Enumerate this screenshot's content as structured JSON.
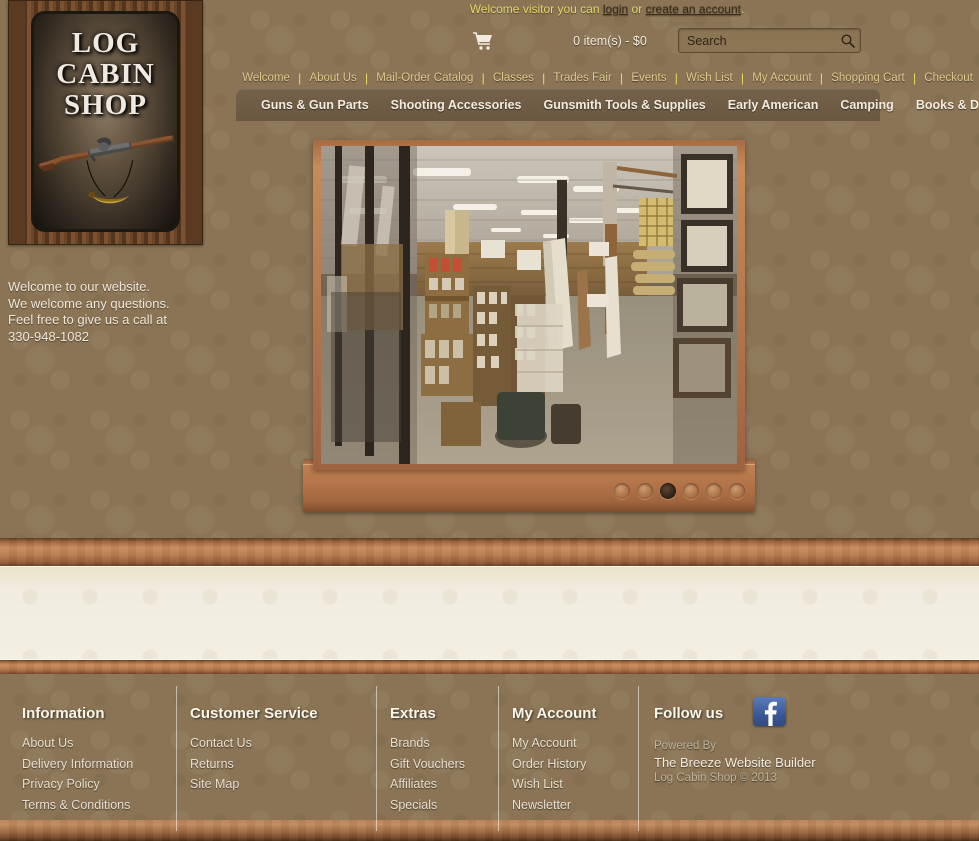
{
  "site": {
    "logo_line1": "LOG",
    "logo_line2": "CABIN",
    "logo_line3": "SHOP",
    "logo_alt": "Log Cabin Shop wooden sign with muzzleloader rifle and powder horn"
  },
  "header": {
    "welcome_prefix": "Welcome visitor you can ",
    "login_label": "login",
    "welcome_mid": " or ",
    "create_account_label": "create an account",
    "welcome_suffix": ".",
    "cart_total": "0 item(s) - $0",
    "cart_icon": "shopping-cart-icon",
    "search_placeholder": "Search",
    "search_value": "",
    "search_icon": "search-icon"
  },
  "top_nav": {
    "items": [
      {
        "label": "Welcome"
      },
      {
        "label": "About Us"
      },
      {
        "label": "Mail-Order Catalog"
      },
      {
        "label": "Classes"
      },
      {
        "label": "Trades Fair"
      },
      {
        "label": "Events"
      },
      {
        "label": "Wish List"
      },
      {
        "label": "My Account"
      },
      {
        "label": "Shopping Cart"
      },
      {
        "label": "Checkout"
      }
    ],
    "separator": "|"
  },
  "category_nav": {
    "items": [
      {
        "label": "Guns & Gun Parts"
      },
      {
        "label": "Shooting Accessories"
      },
      {
        "label": "Gunsmith Tools & Supplies"
      },
      {
        "label": "Early American"
      },
      {
        "label": "Camping"
      },
      {
        "label": "Books & DVDs"
      }
    ]
  },
  "intro": {
    "line1": "Welcome to our website.",
    "line2": "We welcome any questions.",
    "line3": "Feel free to give us a call at",
    "line4": "330-948-1082"
  },
  "slider": {
    "slide_alt": "Interior of the Log Cabin Shop retail store showing aisles of shelving, muzzleloader rifles, supplies and framed pictures",
    "dots": [
      {
        "active": false
      },
      {
        "active": false
      },
      {
        "active": true
      },
      {
        "active": false
      },
      {
        "active": false
      },
      {
        "active": false
      }
    ],
    "active_index": 3,
    "dot_count": 6
  },
  "footer": {
    "columns": [
      {
        "title": "Information",
        "links": [
          {
            "label": "About Us"
          },
          {
            "label": "Delivery Information"
          },
          {
            "label": "Privacy Policy"
          },
          {
            "label": "Terms & Conditions"
          }
        ]
      },
      {
        "title": "Customer Service",
        "links": [
          {
            "label": "Contact Us"
          },
          {
            "label": "Returns"
          },
          {
            "label": "Site Map"
          }
        ]
      },
      {
        "title": "Extras",
        "links": [
          {
            "label": "Brands"
          },
          {
            "label": "Gift Vouchers"
          },
          {
            "label": "Affiliates"
          },
          {
            "label": "Specials"
          }
        ]
      },
      {
        "title": "My Account",
        "links": [
          {
            "label": "My Account"
          },
          {
            "label": "Order History"
          },
          {
            "label": "Wish List"
          },
          {
            "label": "Newsletter"
          }
        ]
      }
    ],
    "follow_title": "Follow us",
    "facebook_icon": "facebook-icon",
    "powered_by": "Powered By",
    "builder": "The Breeze Website Builder",
    "copyright": "Log Cabin Shop © 2013"
  },
  "colors": {
    "background": "#8a7455",
    "nav_link": "#dfcb8f",
    "welcome_text": "#e8d866",
    "catnav_bg": "#6a5841",
    "content_bg": "#f1ece0",
    "wood": "#b87c50",
    "facebook": "#3b5998"
  }
}
